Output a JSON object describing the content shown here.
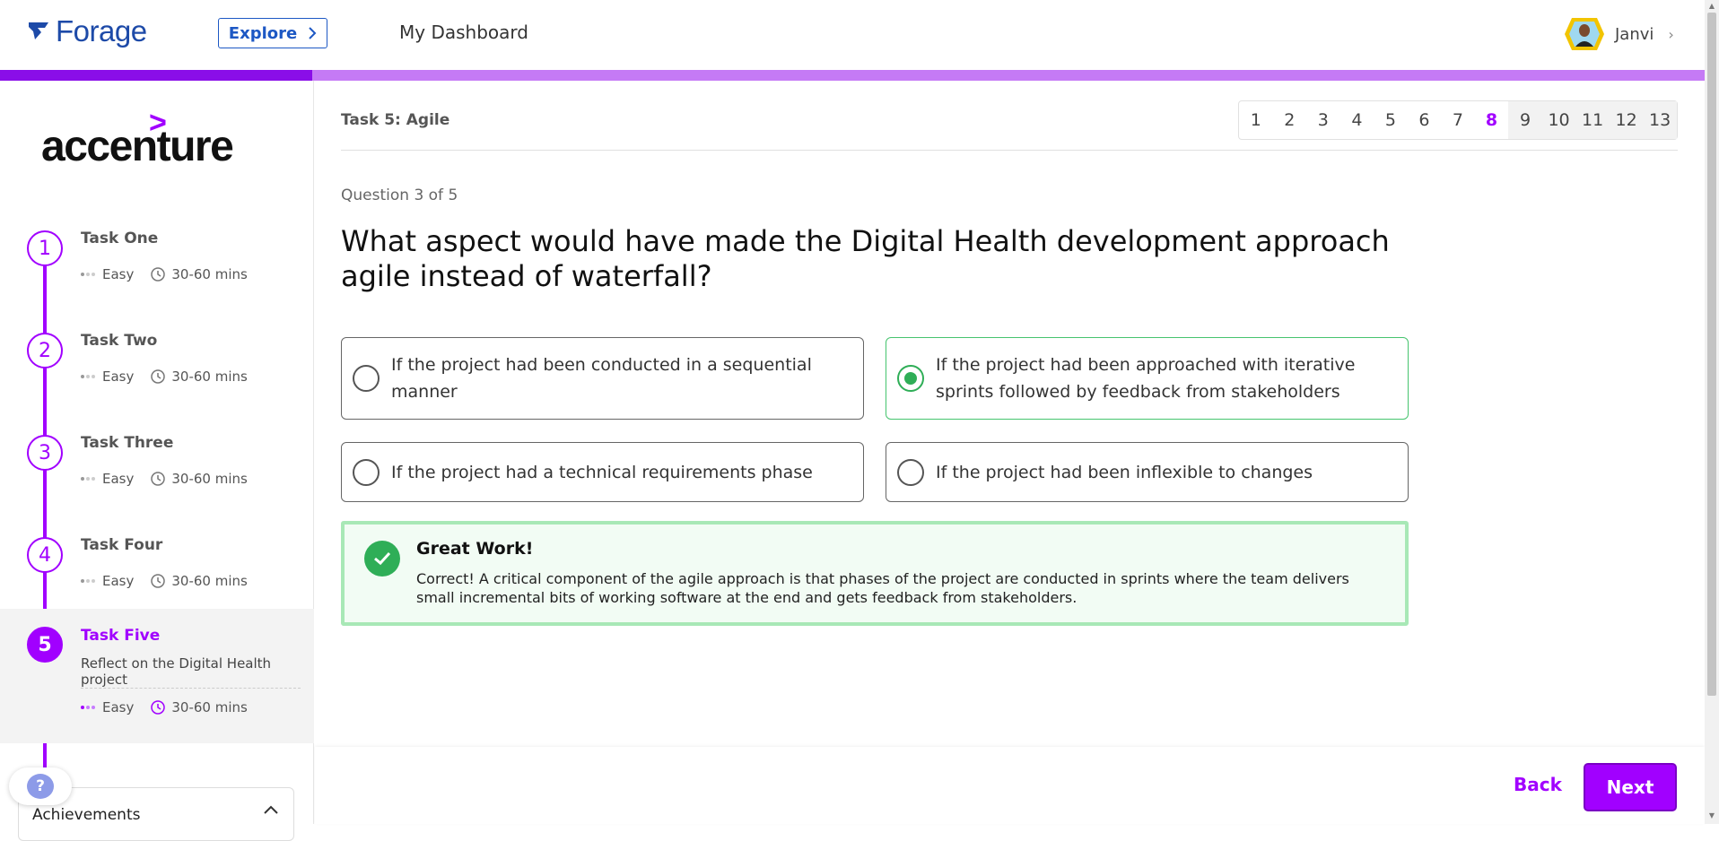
{
  "header": {
    "logo_text": "Forage",
    "explore_label": "Explore",
    "dashboard_label": "My Dashboard",
    "user_name": "Janvi"
  },
  "progress": {
    "fraction": 0.183,
    "fill_color": "#8a0ee8",
    "track_color": "#c57af5"
  },
  "sidebar": {
    "brand": "accenture",
    "tasks": [
      {
        "number": "1",
        "title": "Task One",
        "difficulty": "Easy",
        "duration": "30-60 mins"
      },
      {
        "number": "2",
        "title": "Task Two",
        "difficulty": "Easy",
        "duration": "30-60 mins"
      },
      {
        "number": "3",
        "title": "Task Three",
        "difficulty": "Easy",
        "duration": "30-60 mins"
      },
      {
        "number": "4",
        "title": "Task Four",
        "difficulty": "Easy",
        "duration": "30-60 mins"
      },
      {
        "number": "5",
        "title": "Task Five",
        "subtitle": "Reflect on the Digital Health project",
        "difficulty": "Easy",
        "duration": "30-60 mins"
      }
    ],
    "help_label": "?",
    "achievements_label": "Achievements"
  },
  "main": {
    "task_label": "Task 5: Agile",
    "pages": [
      "1",
      "2",
      "3",
      "4",
      "5",
      "6",
      "7",
      "8",
      "9",
      "10",
      "11",
      "12",
      "13"
    ],
    "current_page": "8",
    "question_count": "Question 3 of 5",
    "question": "What aspect would have made the Digital Health development approach agile instead of waterfall?",
    "options": [
      {
        "text": "If the project had been conducted in a sequential manner",
        "selected": false
      },
      {
        "text": "If the project had been approached with iterative sprints followed by feedback from stakeholders",
        "selected": true
      },
      {
        "text": "If the project had a technical requirements phase",
        "selected": false
      },
      {
        "text": "If the project had been inflexible to changes",
        "selected": false
      }
    ],
    "feedback": {
      "title": "Great Work!",
      "text": "Correct! A critical component of the agile approach is that phases of the project are conducted in sprints where the team delivers small incremental bits of working software at the end and gets feedback from stakeholders."
    }
  },
  "footer": {
    "back_label": "Back",
    "next_label": "Next"
  },
  "colors": {
    "accent": "#a100ff",
    "brand_blue": "#1d4aa8",
    "success": "#2fae57"
  }
}
